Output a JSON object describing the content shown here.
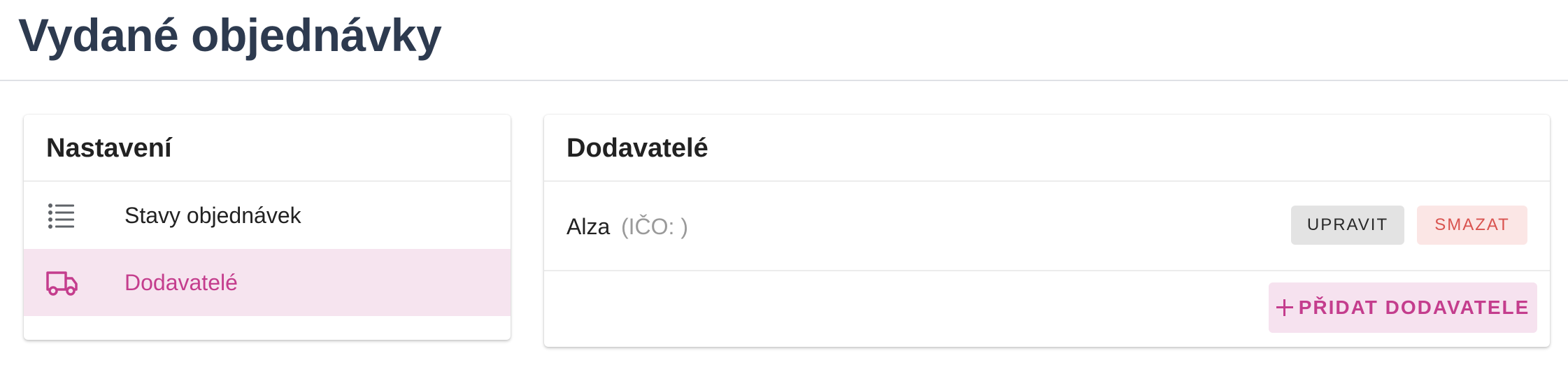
{
  "page": {
    "title": "Vydané objednávky"
  },
  "settings": {
    "title": "Nastavení",
    "items": [
      {
        "label": "Stavy objednávek",
        "icon": "list-icon",
        "active": false
      },
      {
        "label": "Dodavatelé",
        "icon": "truck-icon",
        "active": true
      }
    ]
  },
  "suppliers": {
    "title": "Dodavatelé",
    "rows": [
      {
        "name": "Alza",
        "ico": "(IČO: )",
        "edit_label": "UPRAVIT",
        "delete_label": "SMAZAT"
      }
    ],
    "add_label": "PŘIDAT DODAVATELE"
  },
  "colors": {
    "title": "#2d3a4f",
    "accent": "#c43d8d",
    "active_bg": "#f6e4ef",
    "danger": "#d9534f",
    "danger_bg": "#fbe6e5",
    "neutral_bg": "#e3e3e3"
  }
}
